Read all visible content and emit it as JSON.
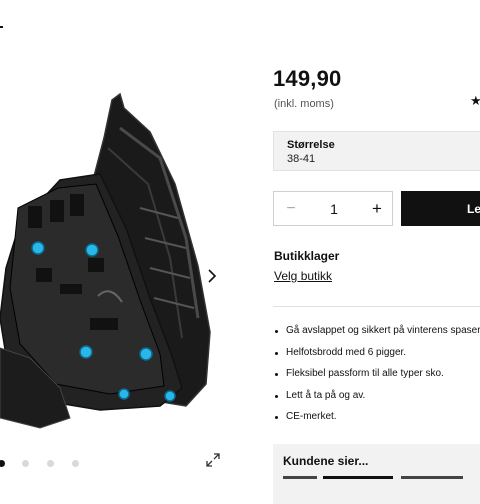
{
  "product": {
    "price": "149,90",
    "vat_note": "(inkl. moms)",
    "rating_icon": "star-icon"
  },
  "size": {
    "label": "Størrelse",
    "value": "38-41"
  },
  "quantity": {
    "minus": "−",
    "value": "1",
    "plus": "+"
  },
  "cart": {
    "button_label": "Le"
  },
  "store": {
    "title": "Butikklager",
    "link": "Velg butikk"
  },
  "features": [
    "Gå avslappet og sikkert på vinterens spaser",
    "Helfotsbrodd med 6 pigger.",
    "Fleksibel passform til alle typer sko.",
    "Lett å ta på og av.",
    "CE-merket."
  ],
  "reviews": {
    "title": "Kundene sier..."
  },
  "gallery": {
    "image_count": 4,
    "active_index": 0,
    "next_icon": "chevron-right-icon",
    "expand_icon": "expand-icon"
  },
  "colors": {
    "accent": "#111111",
    "spike": "#29b6e8",
    "panel": "#f2f2f2"
  }
}
